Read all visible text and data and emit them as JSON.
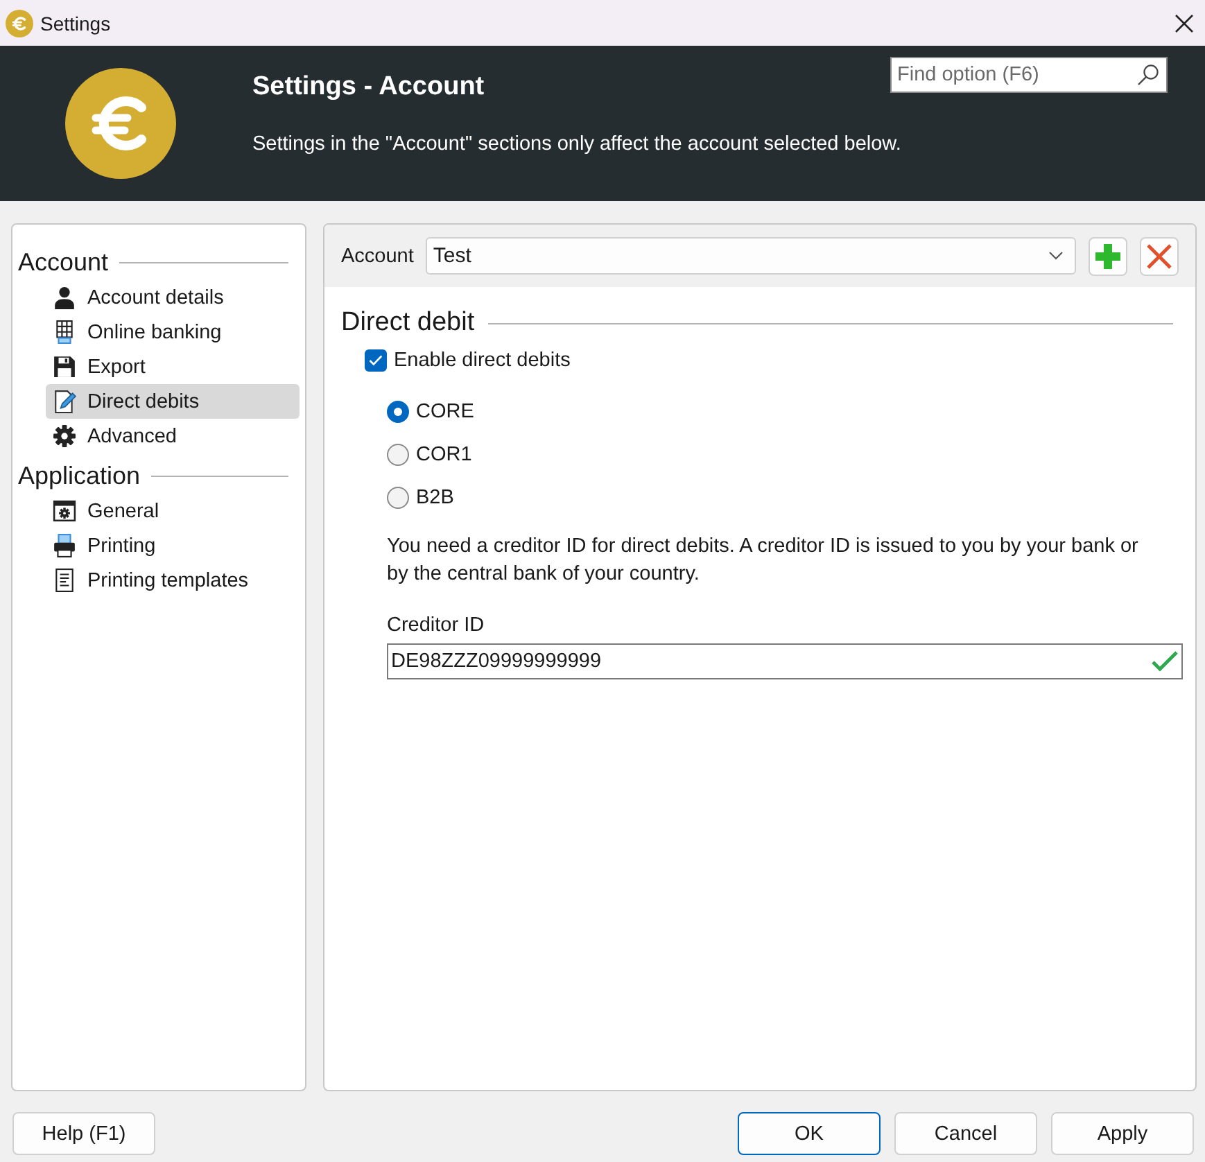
{
  "window": {
    "title": "Settings"
  },
  "header": {
    "title": "Settings - Account",
    "description": "Settings in the \"Account\" sections only affect the account selected below.",
    "search": {
      "placeholder": "Find option (F6)"
    }
  },
  "sidebar": {
    "groups": [
      {
        "title": "Account",
        "items": [
          {
            "label": "Account details",
            "kind": "person",
            "selected": false
          },
          {
            "label": "Online banking",
            "kind": "keypad",
            "selected": false
          },
          {
            "label": "Export",
            "kind": "floppy",
            "selected": false
          },
          {
            "label": "Direct debits",
            "kind": "edit",
            "selected": true
          },
          {
            "label": "Advanced",
            "kind": "gear",
            "selected": false
          }
        ]
      },
      {
        "title": "Application",
        "items": [
          {
            "label": "General",
            "kind": "window",
            "selected": false
          },
          {
            "label": "Printing",
            "kind": "printer",
            "selected": false
          },
          {
            "label": "Printing templates",
            "kind": "document",
            "selected": false
          }
        ]
      }
    ]
  },
  "account": {
    "label": "Account",
    "value": "Test"
  },
  "section": {
    "title": "Direct debit",
    "enable": {
      "label": "Enable direct debits",
      "checked": true
    },
    "schemes": [
      {
        "label": "CORE",
        "selected": true
      },
      {
        "label": "COR1",
        "selected": false
      },
      {
        "label": "B2B",
        "selected": false
      }
    ],
    "note": "You need a creditor ID for direct debits. A creditor ID is issued to you by your bank or by the central bank of your country.",
    "creditor_id": {
      "label": "Creditor ID",
      "value": "DE98ZZZ09999999999",
      "valid": true
    }
  },
  "buttons": {
    "left": [
      {
        "label": "Help (F1)",
        "default": false
      }
    ],
    "right": [
      {
        "label": "OK",
        "default": true
      },
      {
        "label": "Cancel",
        "default": false
      },
      {
        "label": "Apply",
        "default": false
      }
    ]
  }
}
